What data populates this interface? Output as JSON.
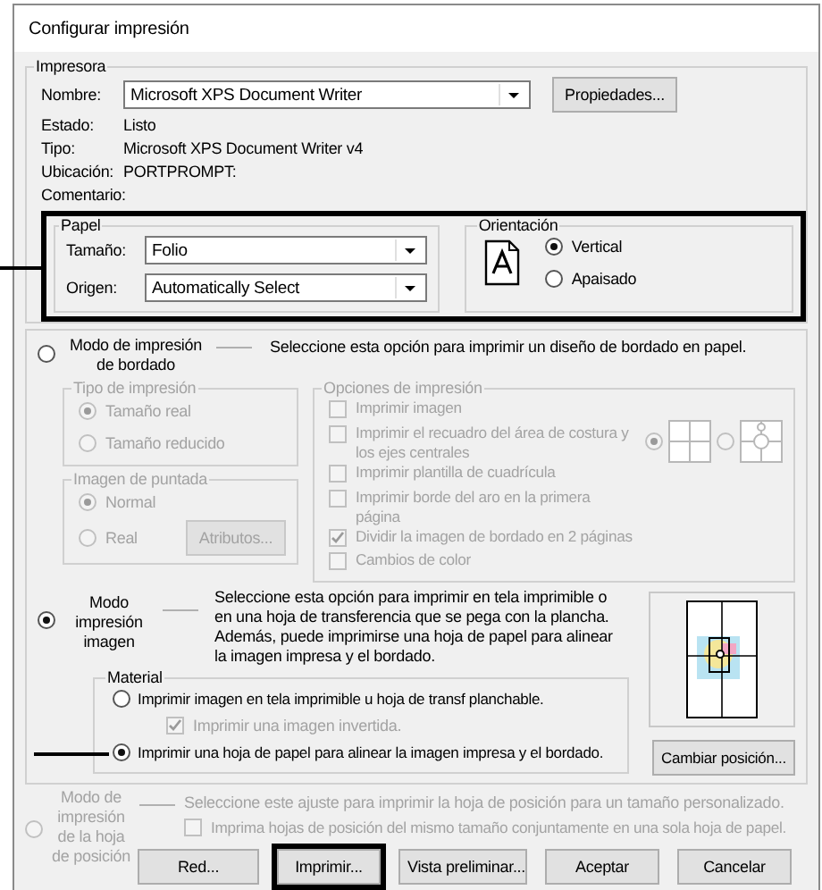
{
  "window": {
    "title": "Configurar impresión"
  },
  "printer": {
    "legend": "Impresora",
    "name_label": "Nombre:",
    "name_value": "Microsoft XPS Document Writer",
    "properties_button": "Propiedades...",
    "details": [
      {
        "label": "Estado:",
        "value": "Listo"
      },
      {
        "label": "Tipo:",
        "value": "Microsoft XPS Document Writer v4"
      },
      {
        "label": "Ubicación:",
        "value": "PORTPROMPT:"
      },
      {
        "label": "Comentario:"
      }
    ]
  },
  "paper_setup": {
    "highlighted": true,
    "paper": {
      "legend": "Papel",
      "fields": [
        {
          "label": "Tamaño:",
          "value": "Folio"
        },
        {
          "label": "Origen:",
          "value": "Automatically Select"
        }
      ]
    },
    "orientation": {
      "legend": "Orientación",
      "options": [
        {
          "label": "Vertical",
          "selected": true
        },
        {
          "label": "Apaisado",
          "selected": false
        }
      ]
    }
  },
  "embroidery_mode": {
    "selected": false,
    "label": "Modo de impresión de bordado",
    "description": "Seleccione esta opción para imprimir un diseño de bordado en papel.",
    "print_type": {
      "legend": "Tipo de impresión",
      "options": [
        {
          "label": "Tamaño real",
          "selected": true
        },
        {
          "label": "Tamaño reducido",
          "selected": false
        }
      ]
    },
    "stitch_image": {
      "legend": "Imagen de puntada",
      "options": [
        {
          "label": "Normal",
          "selected": true
        },
        {
          "label": "Real",
          "selected": false
        }
      ],
      "button": "Atributos..."
    },
    "print_options": {
      "legend": "Opciones de impresión",
      "items": [
        {
          "label": "Imprimir imagen",
          "checked": false
        },
        {
          "label": "Imprimir el recuadro del área de costura y los ejes centrales",
          "checked": false
        },
        {
          "label": "Imprimir plantilla de cuadrícula",
          "checked": false
        },
        {
          "label": "Imprimir borde del aro en la primera página",
          "checked": false
        },
        {
          "label": "Dividir la imagen de bordado en 2 páginas",
          "checked": true
        },
        {
          "label": "Cambios de color",
          "checked": false
        }
      ],
      "layouts": [
        {
          "kind": "grid",
          "selected": true
        },
        {
          "kind": "hoop",
          "selected": false
        }
      ]
    }
  },
  "image_mode": {
    "selected": true,
    "label": "Modo impresión imagen",
    "description": "Seleccione esta opción para imprimir en tela imprimible o en una hoja de transferencia que se pega con la plancha. Además, puede imprimirse una hoja de papel para alinear la imagen impresa y el bordado.",
    "material": {
      "legend": "Material",
      "options": [
        {
          "label": "Imprimir imagen en tela imprimible u hoja de transf planchable.",
          "selected": false,
          "pointed": false,
          "sub_option": {
            "label": "Imprimir una imagen invertida.",
            "checked": true,
            "disabled": true
          }
        },
        {
          "label": "Imprimir una hoja de papel para alinear la imagen impresa y el bordado.",
          "selected": true,
          "pointed": true
        }
      ]
    },
    "position_button": "Cambiar posición..."
  },
  "position_mode": {
    "selected": false,
    "disabled": true,
    "label": "Modo de impresión de la hoja de posición",
    "description": "Seleccione este ajuste para imprimir la hoja de posición para un tamaño personalizado.",
    "option": {
      "label": "Imprima hojas de posición del mismo tamaño conjuntamente en una sola hoja de papel.",
      "checked": false
    }
  },
  "buttons": [
    {
      "label": "Red...",
      "highlighted": false
    },
    {
      "label": "Imprimir...",
      "highlighted": true
    },
    {
      "label": "Vista preliminar...",
      "highlighted": false
    },
    {
      "label": "Aceptar",
      "highlighted": false
    },
    {
      "label": "Cancelar",
      "highlighted": false
    }
  ]
}
